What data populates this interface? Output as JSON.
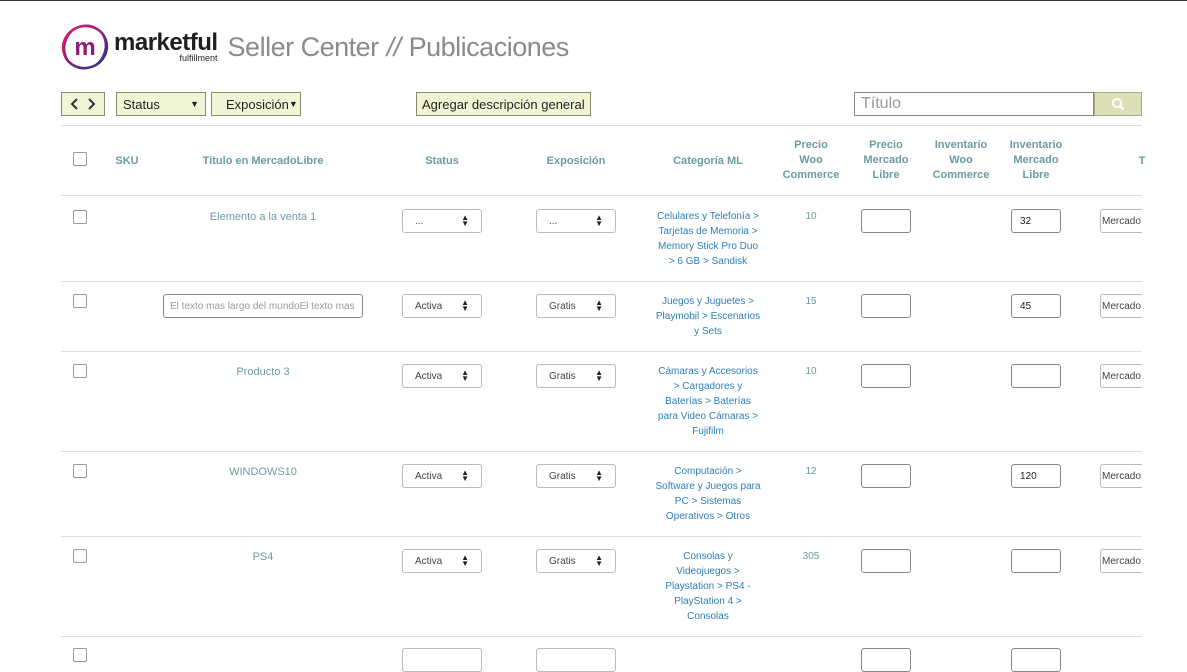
{
  "brand": {
    "name": "marketful",
    "sub": "fulfillment",
    "title": "Seller Center",
    "separator": "//",
    "section": "Publicaciones",
    "colors": {
      "primary": "#8e1b7a",
      "accent": "#c2185b",
      "blue": "#1a3d8f"
    }
  },
  "toolbar": {
    "status_label": "Status",
    "exposicion_label": "Exposición",
    "desc_button": "Agregar descripción general",
    "search_placeholder": "Título"
  },
  "table": {
    "headers": {
      "sku": "SKU",
      "titulo": "Título en MercadoLibre",
      "status": "Status",
      "exposicion": "Exposición",
      "categoria": "Categoría ML",
      "precio_woo": [
        "Precio",
        "Woo",
        "Commerce"
      ],
      "precio_ml": [
        "Precio",
        "Mercado",
        "Libre"
      ],
      "inv_woo": [
        "Inventario",
        "Woo",
        "Commerce"
      ],
      "inv_ml": [
        "Inventario",
        "Mercado",
        "Libre"
      ],
      "tipo": "T"
    },
    "rows": [
      {
        "title": "Elemento a la venta 1",
        "status": "...",
        "exposicion": "...",
        "category": [
          "Celulares y Telefonía >",
          "Tarjetas de Memoria >",
          "Memory Stick Pro Duo",
          "> 6 GB > Sandisk"
        ],
        "price_woo": "10",
        "price_ml": "",
        "inv_ml": "32",
        "tipo": "Mercado"
      },
      {
        "title": "El texto mas largo del mundoEl texto mas",
        "status": "Activa",
        "exposicion": "Gratis",
        "category": [
          "Juegos y Juguetes >",
          "Playmobil > Escenarios",
          "y Sets"
        ],
        "price_woo": "15",
        "price_ml": "",
        "inv_ml": "45",
        "tipo": "Mercado"
      },
      {
        "title": "Producto 3",
        "status": "Activa",
        "exposicion": "Gratis",
        "category": [
          "Cámaras y Accesorios",
          "> Cargadores y",
          "Baterías > Baterías",
          "para Video Cámaras >",
          "Fujifilm"
        ],
        "price_woo": "10",
        "price_ml": "",
        "inv_ml": "",
        "tipo": "Mercado"
      },
      {
        "title": "WINDOWS10",
        "status": "Activa",
        "exposicion": "Gratis",
        "category": [
          "Computación >",
          "Software y Juegos para",
          "PC > Sistemas",
          "Operativos > Otros"
        ],
        "price_woo": "12",
        "price_ml": "",
        "inv_ml": "120",
        "tipo": "Mercado"
      },
      {
        "title": "PS4",
        "status": "Activa",
        "exposicion": "Gratis",
        "category": [
          "Consolas y",
          "Videojuegos >",
          "Playstation > PS4 -",
          "PlayStation 4 >",
          "Consolas"
        ],
        "price_woo": "305",
        "price_ml": "",
        "inv_ml": "",
        "tipo": "Mercado"
      }
    ]
  }
}
